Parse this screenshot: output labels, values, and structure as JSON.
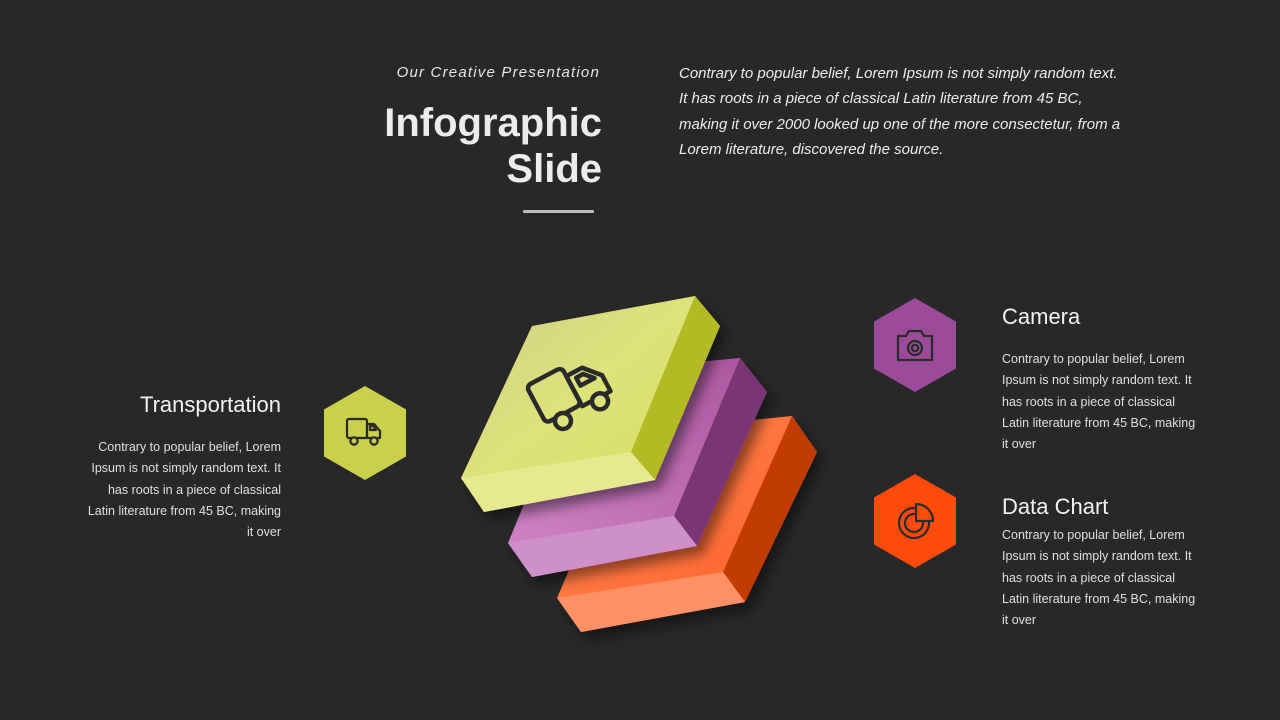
{
  "header": {
    "subtitle": "Our Creative Presentation",
    "title_line1": "Infographic",
    "title_line2": "Slide",
    "intro_lines": [
      "Contrary to popular belief, Lorem Ipsum is not simply random text.",
      "It has roots in a piece of classical Latin literature from 45 BC,",
      "making it over 2000 looked up one of the more consectetur, from a",
      "Lorem literature, discovered the source."
    ]
  },
  "items": {
    "transportation": {
      "title": "Transportation",
      "text_lines": [
        "Contrary to popular belief, Lorem",
        "Ipsum is not simply random text. It",
        "has roots in a piece of classical",
        "Latin literature from 45 BC, making",
        "it over"
      ],
      "icon": "truck-icon",
      "color": "#c9d04a"
    },
    "camera": {
      "title": "Camera",
      "text_lines": [
        "Contrary to popular belief, Lorem",
        "Ipsum is not simply random text. It",
        "has roots in a piece of classical",
        "Latin literature from 45 BC, making",
        "it over"
      ],
      "icon": "camera-icon",
      "color": "#9c4a9c"
    },
    "data_chart": {
      "title": "Data Chart",
      "text_lines": [
        "Contrary to popular belief, Lorem",
        "Ipsum is not simply random text. It",
        "has roots in a piece of classical",
        "Latin literature from 45 BC, making",
        "it over"
      ],
      "icon": "pie-chart-icon",
      "color": "#ff4a0a"
    }
  },
  "stack": {
    "layers": [
      "lime-layer",
      "purple-layer",
      "orange-layer"
    ],
    "top_icon": "truck-icon",
    "colors": {
      "lime": "#d8e06a",
      "purple": "#b465b0",
      "orange": "#ff6a3a"
    }
  }
}
